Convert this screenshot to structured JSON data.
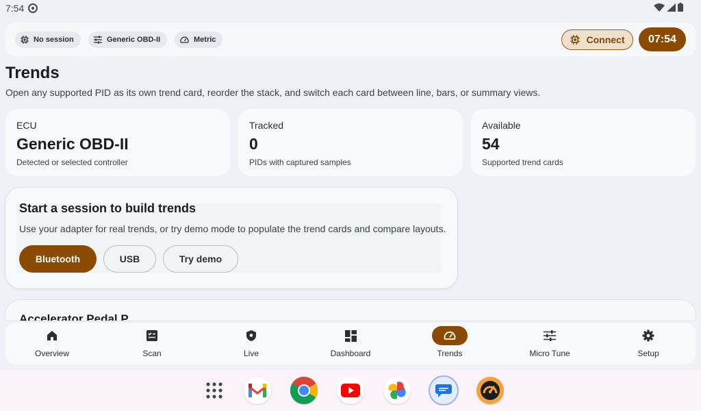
{
  "status_bar": {
    "time": "7:54"
  },
  "appbar": {
    "chips": [
      {
        "label": "No session",
        "icon": "chip-icon"
      },
      {
        "label": "Generic OBD-II",
        "icon": "tune-icon"
      },
      {
        "label": "Metric",
        "icon": "gauge-icon"
      }
    ],
    "connect_label": "Connect",
    "clock": "07:54"
  },
  "page": {
    "title": "Trends",
    "subtitle": "Open any supported PID as its own trend card, reorder the stack, and switch each card between line, bars, or summary views."
  },
  "stats": [
    {
      "label": "ECU",
      "value": "Generic OBD-II",
      "desc": "Detected or selected controller"
    },
    {
      "label": "Tracked",
      "value": "0",
      "desc": "PIDs with captured samples"
    },
    {
      "label": "Available",
      "value": "54",
      "desc": "Supported trend cards"
    }
  ],
  "session": {
    "title": "Start a session to build trends",
    "text": "Use your adapter for real trends, or try demo mode to populate the trend cards and compare layouts.",
    "buttons": {
      "bluetooth": "Bluetooth",
      "usb": "USB",
      "demo": "Try demo"
    }
  },
  "next_card": {
    "title": "Accelerator Pedal P"
  },
  "nav": [
    {
      "label": "Overview",
      "icon": "home-icon"
    },
    {
      "label": "Scan",
      "icon": "checklist-icon"
    },
    {
      "label": "Live",
      "icon": "shield-icon"
    },
    {
      "label": "Dashboard",
      "icon": "dashboard-icon"
    },
    {
      "label": "Trends",
      "icon": "speedometer-icon",
      "active": true
    },
    {
      "label": "Micro Tune",
      "icon": "sliders-icon"
    },
    {
      "label": "Setup",
      "icon": "gear-icon"
    }
  ],
  "colors": {
    "accent": "#8a4b00",
    "accent_soft": "#efe0cb",
    "background": "#eef1f5"
  },
  "taskbar": {
    "apps": [
      "app-drawer-icon",
      "gmail-icon",
      "chrome-icon",
      "youtube-icon",
      "photos-icon",
      "messages-icon",
      "obd-app-icon"
    ]
  }
}
